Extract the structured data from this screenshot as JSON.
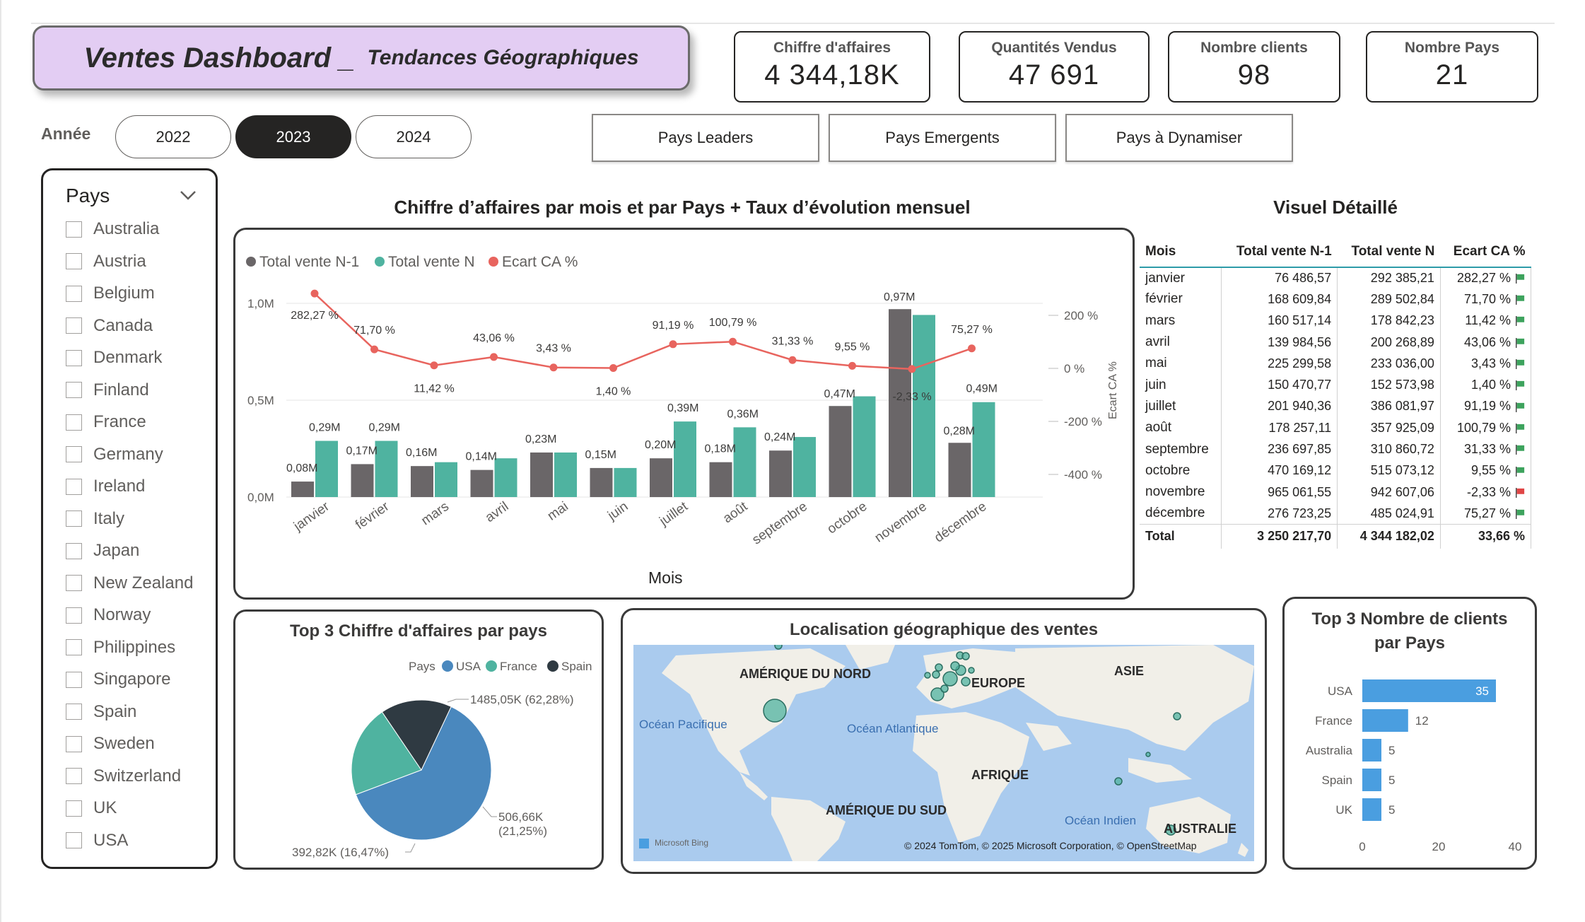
{
  "header": {
    "title_main": "Ventes Dashboard _",
    "title_sub": "Tendances Géographiques"
  },
  "kpis": [
    {
      "label": "Chiffre d'affaires",
      "value": "4 344,18K"
    },
    {
      "label": "Quantités Vendus",
      "value": "47 691"
    },
    {
      "label": "Nombre clients",
      "value": "98"
    },
    {
      "label": "Nombre Pays",
      "value": "21"
    }
  ],
  "year_filter": {
    "label": "Année",
    "options": [
      "2022",
      "2023",
      "2024"
    ],
    "selected": "2023"
  },
  "nav_buttons": [
    "Pays Leaders",
    "Pays Emergents",
    "Pays à Dynamiser"
  ],
  "slicer": {
    "title": "Pays",
    "items": [
      "Australia",
      "Austria",
      "Belgium",
      "Canada",
      "Denmark",
      "Finland",
      "France",
      "Germany",
      "Ireland",
      "Italy",
      "Japan",
      "New Zealand",
      "Norway",
      "Philippines",
      "Singapore",
      "Spain",
      "Sweden",
      "Switzerland",
      "UK",
      "USA"
    ]
  },
  "colors": {
    "bar_prev": "#6a6668",
    "bar_curr": "#4fb3a0",
    "line": "#e8645e",
    "pie_usa": "#4a88be",
    "pie_france": "#4fb3a0",
    "pie_spain": "#2f3a42",
    "hbar": "#4a9ee0",
    "flag_green": "#3da35d",
    "flag_red": "#e04545"
  },
  "chart_data": [
    {
      "type": "bar",
      "title": "Chiffre d’affaires par mois et par Pays + Taux d’évolution mensuel",
      "xlabel": "Mois",
      "ylabel_right": "Ecart CA %",
      "legend": [
        "Total vente N-1",
        "Total vente N",
        "Ecart CA %"
      ],
      "categories": [
        "janvier",
        "février",
        "mars",
        "avril",
        "mai",
        "juin",
        "juillet",
        "août",
        "septembre",
        "octobre",
        "novembre",
        "décembre"
      ],
      "series": [
        {
          "name": "Total vente N-1",
          "values": [
            0.08,
            0.17,
            0.16,
            0.14,
            0.23,
            0.15,
            0.2,
            0.18,
            0.24,
            0.47,
            0.97,
            0.28
          ]
        },
        {
          "name": "Total vente N",
          "values": [
            0.29,
            0.29,
            0.18,
            0.2,
            0.23,
            0.15,
            0.39,
            0.36,
            0.31,
            0.52,
            0.94,
            0.49
          ]
        }
      ],
      "line_series": {
        "name": "Ecart CA %",
        "values": [
          282.27,
          71.7,
          11.42,
          43.06,
          3.43,
          1.4,
          91.19,
          100.79,
          31.33,
          9.55,
          -2.33,
          75.27
        ]
      },
      "bar_labels": [
        "0,08M",
        "0,17M",
        "0,16M",
        "0,14M",
        "0,23M",
        "0,15M",
        "0,20M",
        "0,18M",
        "0,24M",
        "0,47M",
        "0,97M",
        "0,28M"
      ],
      "bar_labels_n": [
        "0,29M",
        "0,29M",
        "",
        "",
        "",
        "",
        "0,39M",
        "0,36M",
        "",
        "",
        "",
        "0,49M"
      ],
      "line_labels": [
        "282,27 %",
        "71,70 %",
        "11,42 %",
        "43,06 %",
        "3,43 %",
        "1,40 %",
        "91,19 %",
        "100,79 %",
        "31,33 %",
        "9,55 %",
        "-2,33 %",
        "75,27 %"
      ],
      "y_ticks": [
        "1,0M",
        "0,5M",
        "0,0M"
      ],
      "y2_ticks": [
        "200 %",
        "0 %",
        "-200 %",
        "-400 %"
      ],
      "ylim": [
        0,
        1.0
      ],
      "y2lim": [
        -500,
        300
      ]
    },
    {
      "type": "pie",
      "title": "Top 3 Chiffre d'affaires par pays",
      "legend_title": "Pays",
      "categories": [
        "USA",
        "France",
        "Spain"
      ],
      "values": [
        1485.05,
        506.66,
        392.82
      ],
      "labels": [
        "1485,05K (62,28%)",
        "506,66K (21,25%)",
        "392,82K (16,47%)"
      ]
    },
    {
      "type": "bar",
      "orientation": "horizontal",
      "title": "Top 3 Nombre de clients par Pays",
      "categories": [
        "USA",
        "France",
        "Australia",
        "Spain",
        "UK"
      ],
      "values": [
        35,
        12,
        5,
        5,
        5
      ],
      "x_ticks": [
        "0",
        "20",
        "40"
      ],
      "xlim": [
        0,
        40
      ]
    }
  ],
  "detail_table": {
    "title": "Visuel Détaillé",
    "columns": [
      "Mois",
      "Total vente N-1",
      "Total vente N",
      "Ecart CA %"
    ],
    "rows": [
      [
        "janvier",
        "76 486,57",
        "292 385,21",
        "282,27 %",
        "up"
      ],
      [
        "février",
        "168 609,84",
        "289 502,84",
        "71,70 %",
        "up"
      ],
      [
        "mars",
        "160 517,14",
        "178 842,23",
        "11,42 %",
        "up"
      ],
      [
        "avril",
        "139 984,56",
        "200 268,89",
        "43,06 %",
        "up"
      ],
      [
        "mai",
        "225 299,58",
        "233 036,00",
        "3,43 %",
        "up"
      ],
      [
        "juin",
        "150 470,77",
        "152 573,98",
        "1,40 %",
        "up"
      ],
      [
        "juillet",
        "201 940,36",
        "386 081,97",
        "91,19 %",
        "up"
      ],
      [
        "août",
        "178 257,11",
        "357 925,09",
        "100,79 %",
        "up"
      ],
      [
        "septembre",
        "236 697,85",
        "310 860,72",
        "31,33 %",
        "up"
      ],
      [
        "octobre",
        "470 169,12",
        "515 073,12",
        "9,55 %",
        "up"
      ],
      [
        "novembre",
        "965 061,55",
        "942 607,06",
        "-2,33 %",
        "down"
      ],
      [
        "décembre",
        "276 723,25",
        "485 024,91",
        "75,27 %",
        "up"
      ]
    ],
    "total": [
      "Total",
      "3 250 217,70",
      "4 344 182,02",
      "33,66 %"
    ]
  },
  "map": {
    "title": "Localisation géographique des ventes",
    "labels": [
      "AMÉRIQUE DU NORD",
      "EUROPE",
      "ASIE",
      "AFRIQUE",
      "AMÉRIQUE DU SUD",
      "AUSTRALIE",
      "Océan Pacifique",
      "Océan Atlantique",
      "Océan Indien"
    ],
    "attribution": "© 2024 TomTom, © 2025 Microsoft Corporation, © OpenStreetMap",
    "provider": "Microsoft Bing"
  }
}
